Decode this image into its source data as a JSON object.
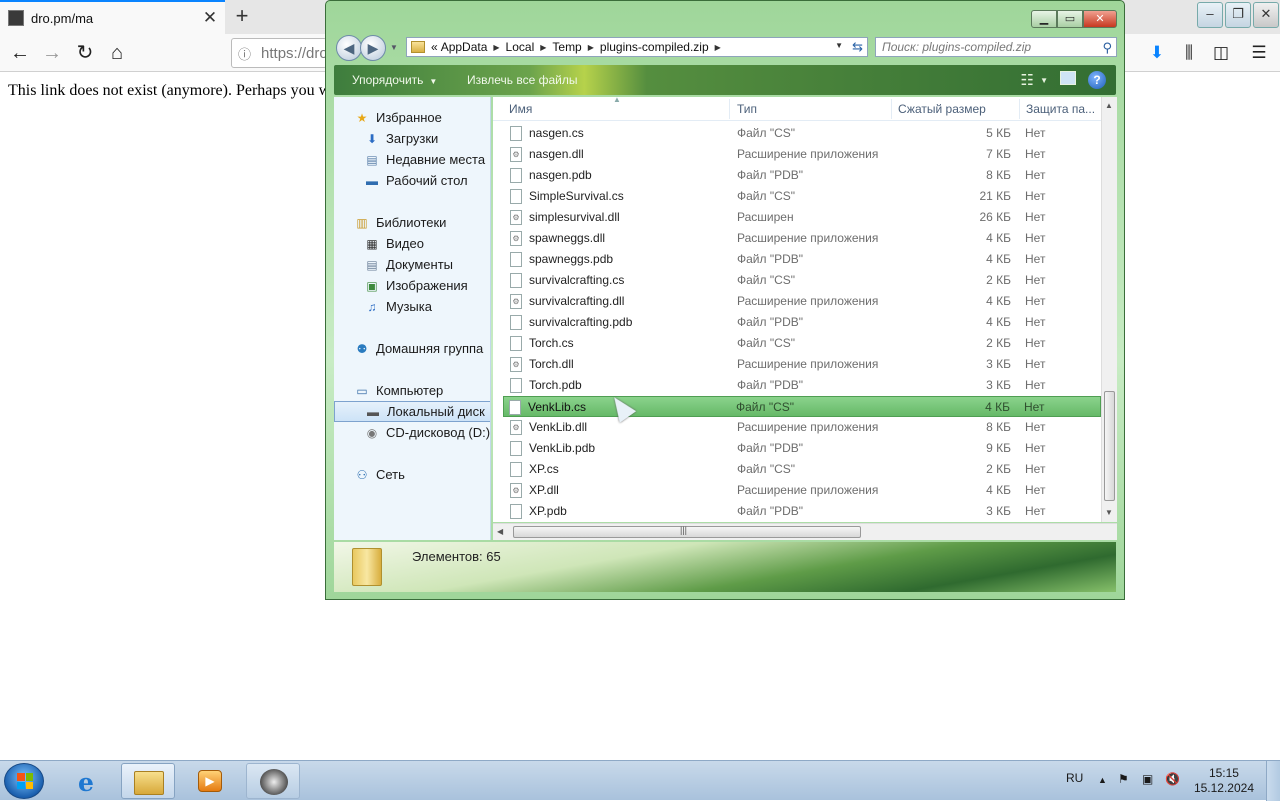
{
  "browser": {
    "tab_title": "dro.pm/ma",
    "url_text": "https://dro",
    "page_text": "This link does not exist (anymore). Perhaps you w",
    "icons": [
      "back-icon",
      "forward-icon",
      "reload-icon",
      "home-icon",
      "download-icon",
      "library-icon",
      "sidebar-icon",
      "menu-icon"
    ]
  },
  "explorer": {
    "breadcrumb": {
      "overflow": "«",
      "items": [
        "AppData",
        "Local",
        "Temp",
        "plugins-compiled.zip"
      ]
    },
    "search_placeholder": "Поиск: plugins-compiled.zip",
    "toolbar": {
      "organize": "Упорядочить",
      "extract_all": "Извлечь все файлы"
    },
    "columns": {
      "name": "Имя",
      "type": "Тип",
      "compressed_size": "Сжатый размер",
      "protection": "Защита па..."
    },
    "nav": {
      "favorites": "Избранное",
      "downloads": "Загрузки",
      "recent": "Недавние места",
      "desktop": "Рабочий стол",
      "libraries": "Библиотеки",
      "videos": "Видео",
      "documents": "Документы",
      "pictures": "Изображения",
      "music": "Музыка",
      "homegroup": "Домашняя группа",
      "computer": "Компьютер",
      "local_disk": "Локальный диск",
      "cd_drive": "CD-дисковод (D:)",
      "network": "Сеть"
    },
    "files": [
      {
        "name": "nasgen.cs",
        "type": "Файл \"CS\"",
        "size": "5 КБ",
        "protected": "Нет"
      },
      {
        "name": "nasgen.dll",
        "type": "Расширение приложения",
        "size": "7 КБ",
        "protected": "Нет"
      },
      {
        "name": "nasgen.pdb",
        "type": "Файл \"PDB\"",
        "size": "8 КБ",
        "protected": "Нет"
      },
      {
        "name": "SimpleSurvival.cs",
        "type": "Файл \"CS\"",
        "size": "21 КБ",
        "protected": "Нет"
      },
      {
        "name": "simplesurvival.dll",
        "type": "Расширен",
        "size": "26 КБ",
        "protected": "Нет"
      },
      {
        "name": "spawneggs.dll",
        "type": "Расширение приложения",
        "size": "4 КБ",
        "protected": "Нет"
      },
      {
        "name": "spawneggs.pdb",
        "type": "Файл \"PDB\"",
        "size": "4 КБ",
        "protected": "Нет"
      },
      {
        "name": "survivalcrafting.cs",
        "type": "Файл \"CS\"",
        "size": "2 КБ",
        "protected": "Нет"
      },
      {
        "name": "survivalcrafting.dll",
        "type": "Расширение приложения",
        "size": "4 КБ",
        "protected": "Нет"
      },
      {
        "name": "survivalcrafting.pdb",
        "type": "Файл \"PDB\"",
        "size": "4 КБ",
        "protected": "Нет"
      },
      {
        "name": "Torch.cs",
        "type": "Файл \"CS\"",
        "size": "2 КБ",
        "protected": "Нет"
      },
      {
        "name": "Torch.dll",
        "type": "Расширение приложения",
        "size": "3 КБ",
        "protected": "Нет"
      },
      {
        "name": "Torch.pdb",
        "type": "Файл \"PDB\"",
        "size": "3 КБ",
        "protected": "Нет"
      },
      {
        "name": "VenkLib.cs",
        "type": "Файл \"CS\"",
        "size": "4 КБ",
        "protected": "Нет",
        "selected": true
      },
      {
        "name": "VenkLib.dll",
        "type": "Расширение приложения",
        "size": "8 КБ",
        "protected": "Нет"
      },
      {
        "name": "VenkLib.pdb",
        "type": "Файл \"PDB\"",
        "size": "9 КБ",
        "protected": "Нет"
      },
      {
        "name": "XP.cs",
        "type": "Файл \"CS\"",
        "size": "2 КБ",
        "protected": "Нет"
      },
      {
        "name": "XP.dll",
        "type": "Расширение приложения",
        "size": "4 КБ",
        "protected": "Нет"
      },
      {
        "name": "XP.pdb",
        "type": "Файл \"PDB\"",
        "size": "3 КБ",
        "protected": "Нет"
      }
    ],
    "status": "Элементов: 65",
    "scroll_marker": "|||"
  },
  "taskbar": {
    "language": "RU",
    "time": "15:15",
    "date": "15.12.2024",
    "pinned": [
      "internet-explorer-icon",
      "file-explorer-icon",
      "media-player-icon",
      "app-icon"
    ]
  },
  "colors": {
    "selection": "#66b968",
    "accent": "#0a84ff",
    "aero_green": "#3e7d3d"
  }
}
